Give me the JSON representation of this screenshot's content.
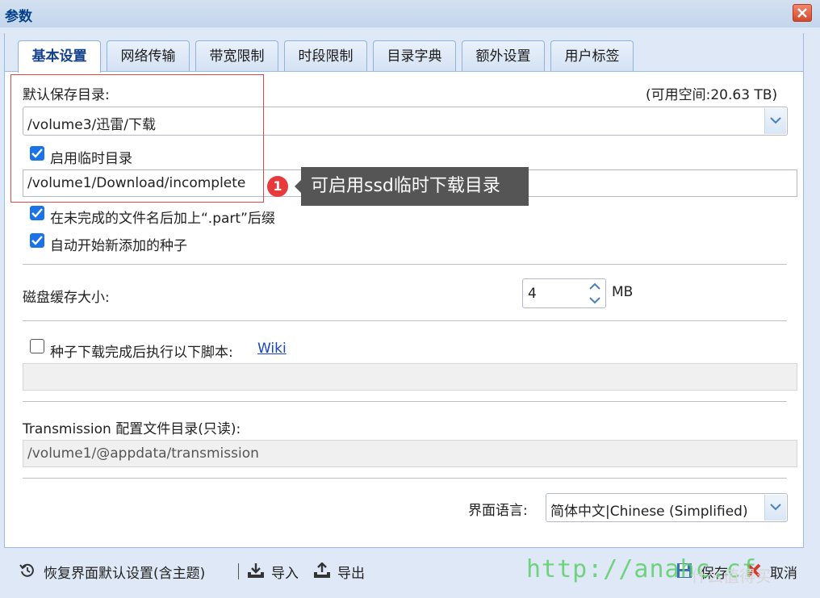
{
  "window": {
    "title": "参数"
  },
  "tabs": [
    {
      "label": "基本设置",
      "active": true
    },
    {
      "label": "网络传输",
      "active": false
    },
    {
      "label": "带宽限制",
      "active": false
    },
    {
      "label": "时段限制",
      "active": false
    },
    {
      "label": "目录字典",
      "active": false
    },
    {
      "label": "额外设置",
      "active": false
    },
    {
      "label": "用户标签",
      "active": false
    }
  ],
  "download_dir": {
    "label": "默认保存目录:",
    "free_space": "(可用空间:20.63 TB)",
    "value": "/volume3/迅雷/下载"
  },
  "incomplete": {
    "checkbox_label": "启用临时目录",
    "checked": true,
    "value": "/volume1/Download/incomplete"
  },
  "annotation": {
    "number": "1",
    "text": "可启用ssd临时下载目录"
  },
  "options": {
    "rename_partial": {
      "label": "在未完成的文件名后加上“.part”后缀",
      "checked": true
    },
    "autostart": {
      "label": "自动开始新添加的种子",
      "checked": true
    }
  },
  "cache": {
    "label": "磁盘缓存大小:",
    "value": "4",
    "unit": "MB"
  },
  "script": {
    "checkbox_label": "种子下载完成后执行以下脚本:",
    "checked": false,
    "link": "Wiki",
    "value": ""
  },
  "config_dir": {
    "label": "Transmission 配置文件目录(只读):",
    "value": "/volume1/@appdata/transmission"
  },
  "language": {
    "label": "界面语言:",
    "value": "简体中文|Chinese (Simplified)"
  },
  "footer": {
    "restore": "恢复界面默认设置(含主题)",
    "import": "导入",
    "export": "导出",
    "save": "保存",
    "cancel": "取消"
  },
  "watermark": {
    "url": "http://anahc.cf",
    "site": "什么值得买"
  },
  "colors": {
    "accent": "#15428b",
    "checkbox": "#1a73e8",
    "callout": "#555555",
    "badge": "#e83a3a"
  }
}
